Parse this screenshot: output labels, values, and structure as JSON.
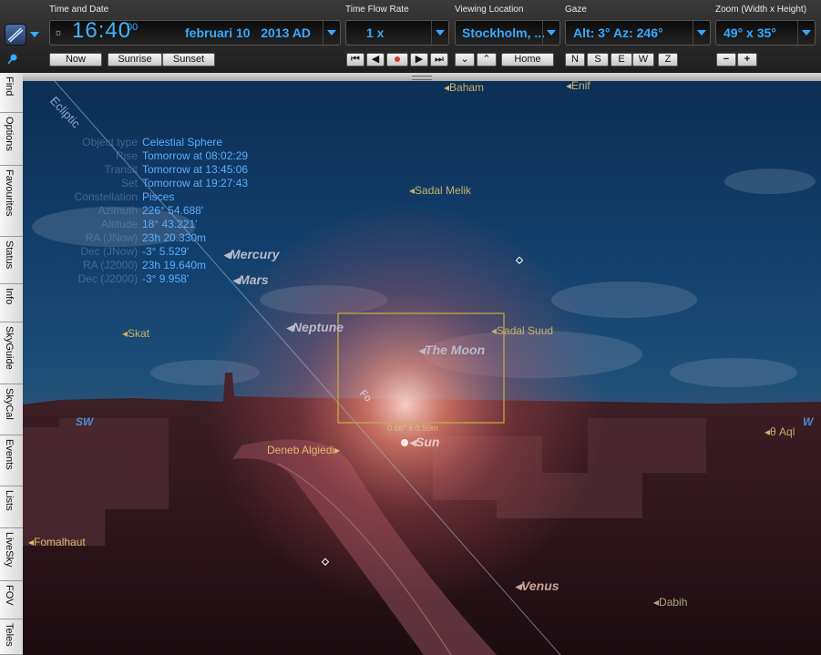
{
  "toolbar": {
    "time_date": {
      "label": "Time and Date",
      "time": "16:40",
      "seconds": "00",
      "date": "februari 10   2013 AD",
      "buttons": [
        "Now",
        "Sunrise",
        "Sunset"
      ]
    },
    "flow": {
      "label": "Time Flow Rate",
      "value": "1 x"
    },
    "location": {
      "label": "Viewing Location",
      "value": "Stockholm, ...",
      "home": "Home"
    },
    "gaze": {
      "label": "Gaze",
      "value": "Alt: 3° Az: 246°",
      "directions": [
        "N",
        "S",
        "E",
        "W",
        "Z"
      ]
    },
    "zoom": {
      "label": "Zoom (Width x Height)",
      "value": "49° x 35°",
      "minus": "−",
      "plus": "+"
    }
  },
  "sidebar": {
    "tabs": [
      "Find",
      "Options",
      "Favourites",
      "Status",
      "Info",
      "SkyGuide",
      "SkyCal",
      "Events",
      "Lists",
      "LiveSky",
      "FOV",
      "Teles"
    ]
  },
  "info_panel": [
    {
      "key": "Object type",
      "value": "Celestial Sphere"
    },
    {
      "key": "Rise",
      "value": "Tomorrow at 08:02:29"
    },
    {
      "key": "Transit",
      "value": "Tomorrow at 13:45:06"
    },
    {
      "key": "Set",
      "value": "Tomorrow at 19:27:43"
    },
    {
      "key": "Constellation",
      "value": "Pisces"
    },
    {
      "key": "Azimuth",
      "value": "226° 54.688'"
    },
    {
      "key": "Altitude",
      "value": "18° 43.221'"
    },
    {
      "key": "RA (JNow)",
      "value": "23h 20.330m"
    },
    {
      "key": "Dec (JNow)",
      "value": "-3° 5.529'"
    },
    {
      "key": "RA (J2000)",
      "value": "23h 19.640m"
    },
    {
      "key": "Dec (J2000)",
      "value": "-3° 9.958'"
    }
  ],
  "sky": {
    "ecliptic": "Ecliptic",
    "horizon_sw": "SW",
    "horizon_w": "W",
    "fov_label": "Fo",
    "fov_size": "0.66° x 0.50m",
    "labels": {
      "baham": "Baham",
      "enif": "Enif",
      "sadal_melik": "Sadal Melik",
      "mercury": "Mercury",
      "mars": "Mars",
      "neptune": "Neptune",
      "skat": "Skat",
      "sadal_suud": "Sadal Suud",
      "moon": "The Moon",
      "sun": "Sun",
      "deneb": "Deneb Algiedi",
      "aql": "θ Aql",
      "fomalhaut": "Fomalhaut",
      "venus": "Venus",
      "dabih": "Dabih"
    }
  },
  "colors": {
    "accent": "#36aaff",
    "star_label": "#c8b06a",
    "planet_label": "#b9b9c8",
    "sky_top": "#0c2f55",
    "ground": "#3b1d22"
  }
}
